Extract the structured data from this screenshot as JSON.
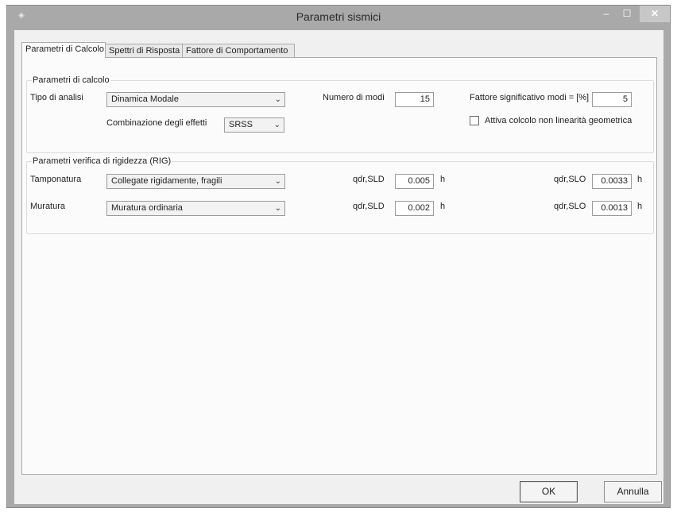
{
  "window": {
    "title": "Parametri sismici",
    "controls": {
      "minimize": "–",
      "maximize": "☐",
      "close": "✕"
    }
  },
  "tabs": [
    {
      "label": "Parametri di Calcolo",
      "active": true
    },
    {
      "label": "Spettri di Risposta",
      "active": false
    },
    {
      "label": "Fattore  di Comportamento",
      "active": false
    }
  ],
  "calc": {
    "group_title": "Parametri di calcolo",
    "analysis_label": "Tipo di analisi",
    "analysis_value": "Dinamica Modale",
    "combination_label": "Combinazione degli effetti",
    "combination_value": "SRSS",
    "modes_label": "Numero di modi",
    "modes_value": "15",
    "factor_label": "Fattore significativo modi = [%]",
    "factor_value": "5",
    "nonlinear_label": "Attiva colcolo non linearità geometrica",
    "nonlinear_checked": false
  },
  "rig": {
    "group_title": "Parametri verifica di rigidezza (RIG)",
    "rows": [
      {
        "label": "Tamponatura",
        "value": "Collegate rigidamente, fragili",
        "sld_label": "qdr,SLD",
        "sld_value": "0.005",
        "sld_unit": "h",
        "slo_label": "qdr,SLO",
        "slo_value": "0.0033",
        "slo_unit": "h"
      },
      {
        "label": "Muratura",
        "value": "Muratura ordinaria",
        "sld_label": "qdr,SLD",
        "sld_value": "0.002",
        "sld_unit": "h",
        "slo_label": "qdr,SLO",
        "slo_value": "0.0013",
        "slo_unit": "h"
      }
    ]
  },
  "buttons": {
    "ok": "OK",
    "cancel": "Annulla"
  },
  "icons": {
    "dropdown": "chevron-down-icon"
  }
}
